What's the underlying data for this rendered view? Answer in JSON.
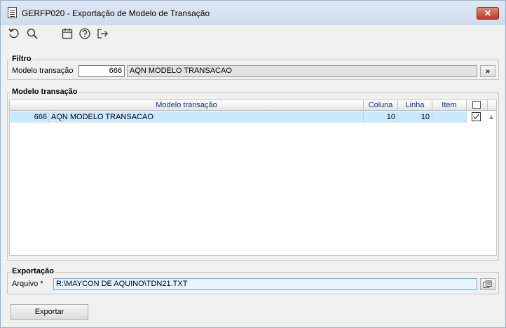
{
  "window": {
    "title": "GERFP020 - Exportação de Modelo de Transação",
    "close_label": "✕"
  },
  "toolbar": {
    "icons": [
      "refresh-icon",
      "search-icon",
      "calendar-icon",
      "help-icon",
      "exit-icon"
    ]
  },
  "filtro": {
    "group_label": "Filtro",
    "field_label": "Modelo transação",
    "code_value": "666",
    "description_value": "AQN MODELO TRANSACAO",
    "lookup_button_label": "»"
  },
  "modelo": {
    "group_label": "Modelo transação",
    "columns": {
      "modelo": "Modelo transação",
      "coluna": "Coluna",
      "linha": "Linha",
      "item": "Item"
    },
    "rows": [
      {
        "code": "666",
        "description": "AQN MODELO TRANSACAO",
        "coluna": "10",
        "linha": "10",
        "item": "",
        "checked": true
      }
    ]
  },
  "exportacao": {
    "group_label": "Exportação",
    "field_label": "Arquivo *",
    "file_value": "R:\\MAYCON DE AQUINO\\TDN21.TXT"
  },
  "actions": {
    "export_label": "Exportar"
  }
}
